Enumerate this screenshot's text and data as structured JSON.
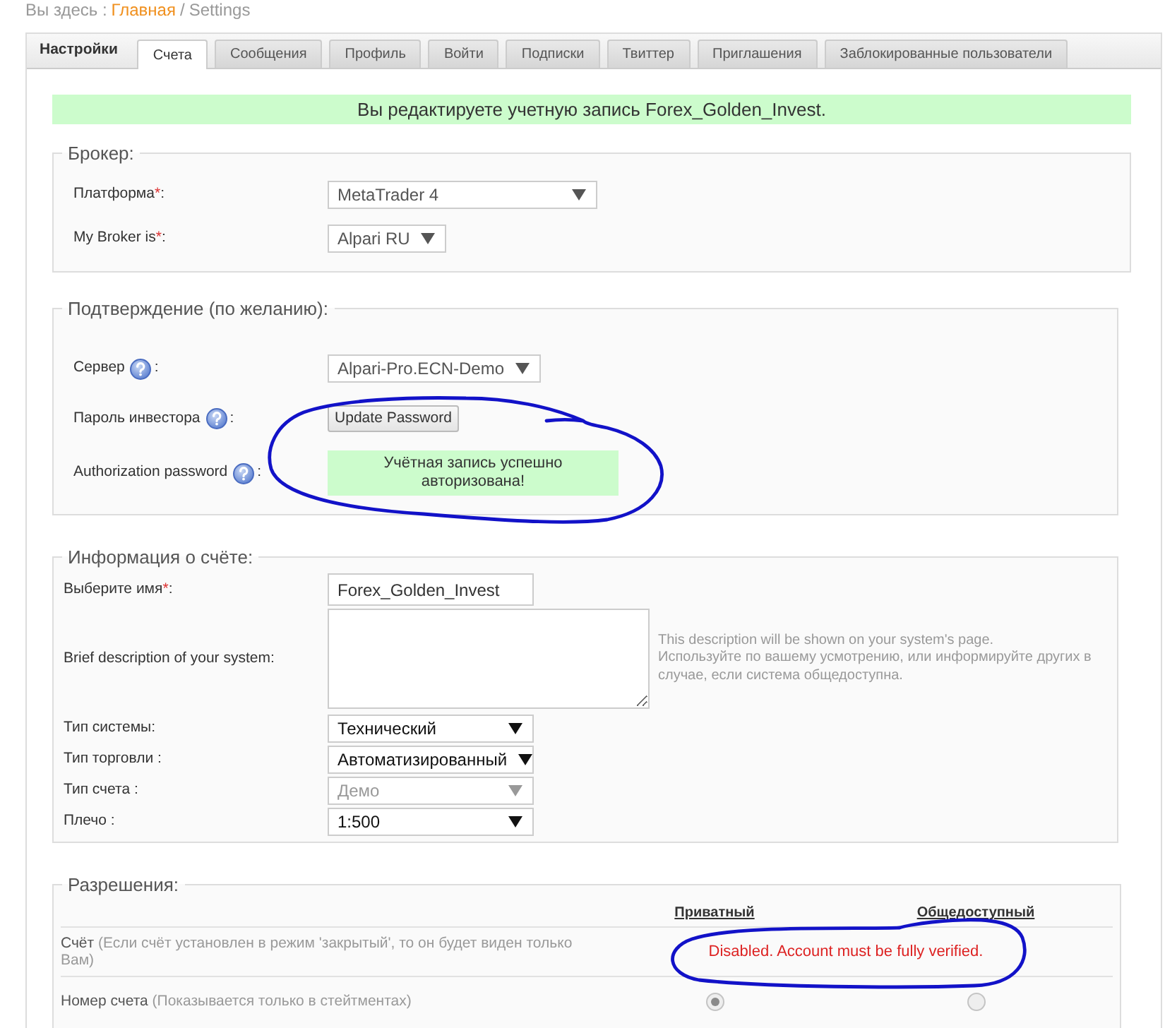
{
  "breadcrumb": {
    "label": "Вы здесь :",
    "home_link": "Главная",
    "separator": "/",
    "current": "Settings"
  },
  "tab_bar": {
    "title": "Настройки",
    "tabs": [
      {
        "label": "Счета",
        "selected": true
      },
      {
        "label": "Сообщения",
        "selected": false
      },
      {
        "label": "Профиль",
        "selected": false
      },
      {
        "label": "Войти",
        "selected": false
      },
      {
        "label": "Подписки",
        "selected": false
      },
      {
        "label": "Твиттер",
        "selected": false
      },
      {
        "label": "Приглашения",
        "selected": false
      },
      {
        "label": "Заблокированные пользователи",
        "selected": false
      }
    ]
  },
  "notice": "Вы редактируете учетную запись Forex_Golden_Invest.",
  "broker": {
    "legend": "Брокер:",
    "fields": [
      {
        "label": "Платформа",
        "required_mark": "*",
        "suffix": ":",
        "kind": "select",
        "value": "MetaTrader 4"
      },
      {
        "label": "My Broker is",
        "required_mark": "*",
        "suffix": ":",
        "kind": "select",
        "value": "Alpari RU"
      }
    ]
  },
  "confirmation": {
    "legend": "Подтверждение (по желанию):",
    "fields": [
      {
        "label": "Сервер",
        "help": true,
        "suffix": ":",
        "kind": "select",
        "value": "Alpari-Pro.ECN-Demo"
      },
      {
        "label": "Пароль инвестора",
        "help": true,
        "suffix": ":",
        "kind": "button",
        "value": "Update Password"
      },
      {
        "label": "Authorization password",
        "help": true,
        "suffix": ":",
        "kind": "status",
        "value": "Учётная запись успешно авторизована!"
      }
    ]
  },
  "account_info": {
    "legend": "Информация о счёте:",
    "fields": [
      {
        "label": "Выберите имя",
        "required_mark": "*",
        "suffix": ":",
        "kind": "input",
        "value": "Forex_Golden_Invest"
      },
      {
        "label": "Brief description of your system:",
        "kind": "textarea",
        "hint": [
          "This description will be shown on your system's page.",
          "Используйте по вашему усмотрению, или информируйте других в случае, если система общедоступна."
        ]
      },
      {
        "label": "Тип системы:",
        "kind": "select",
        "value": "Технический",
        "disabled": false
      },
      {
        "label": "Тип торговли :",
        "kind": "select",
        "value": "Автоматизированный",
        "disabled": false
      },
      {
        "label": "Тип счета :",
        "kind": "select",
        "value": "Демо",
        "disabled": true
      },
      {
        "label": "Плечо :",
        "kind": "select",
        "value": "1:500",
        "disabled": false
      }
    ]
  },
  "permissions": {
    "legend": "Разрешения:",
    "columns": [
      "Приватный",
      "Общедоступный"
    ],
    "rows": [
      {
        "label": "Счёт",
        "note": "(Если счёт установлен в режим 'закрытый', то он будет виден только Вам)",
        "kind": "message",
        "message": "Disabled. Account must be fully verified."
      },
      {
        "label": "Номер счета",
        "note": "(Показывается только в стейтментах)",
        "kind": "radios",
        "options": [
          {
            "selected": true,
            "disabled": true
          },
          {
            "selected": false,
            "disabled": true
          }
        ]
      }
    ]
  }
}
